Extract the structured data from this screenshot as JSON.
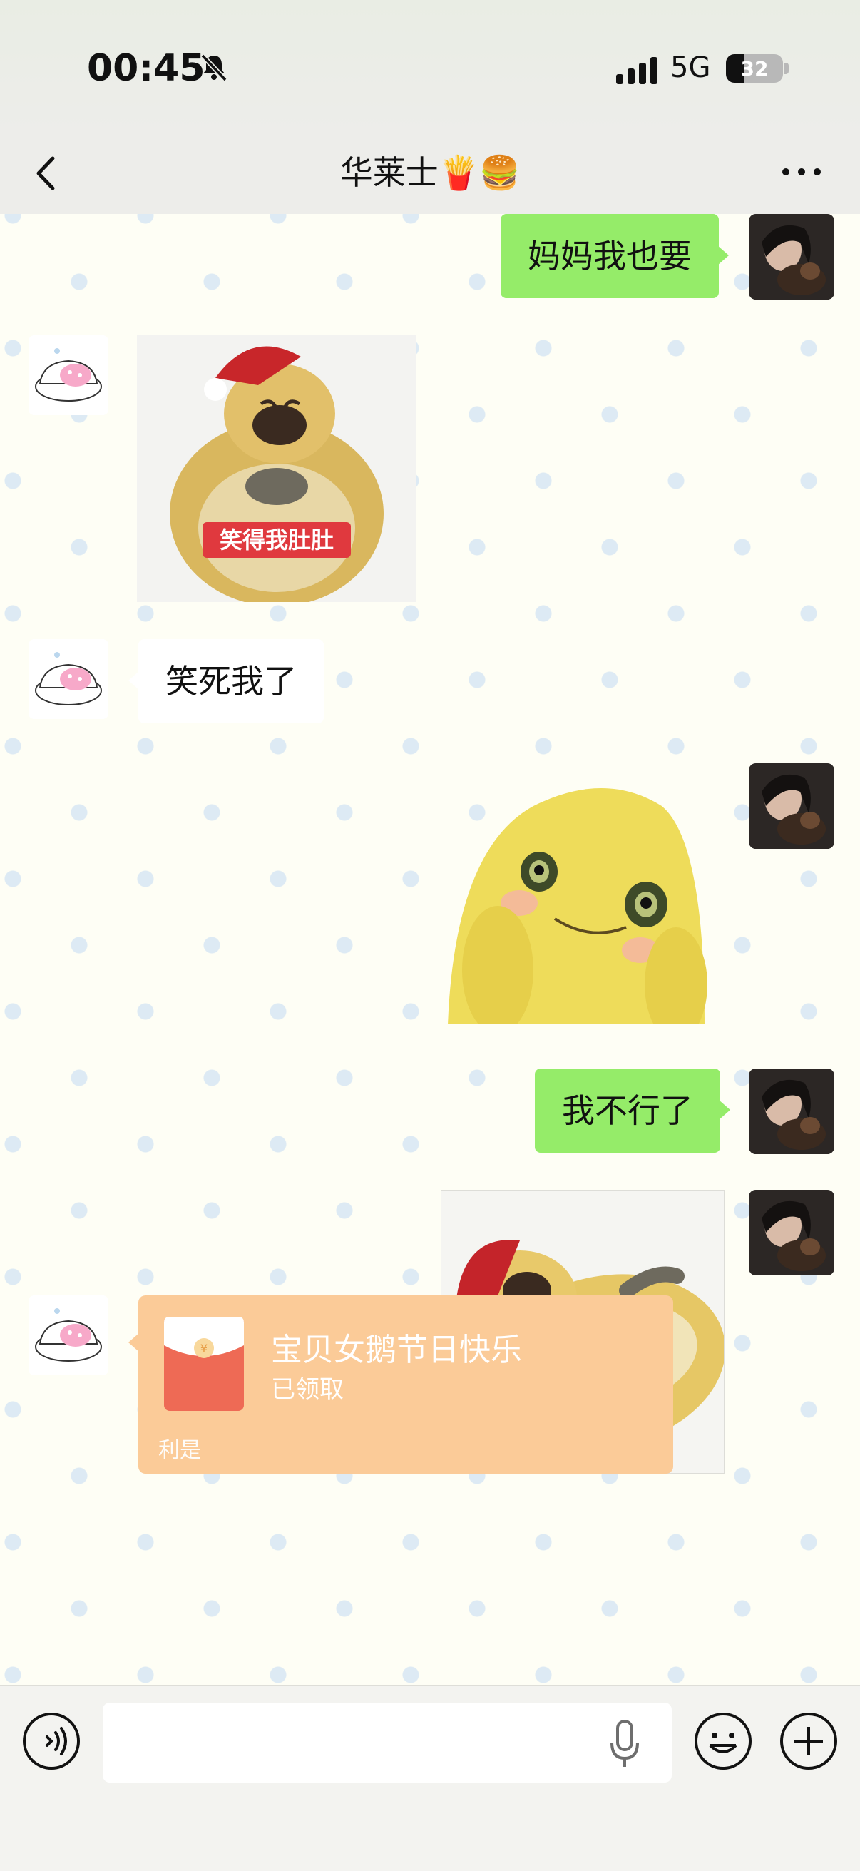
{
  "status_bar": {
    "time": "00:45",
    "network": "5G",
    "battery_level": "32",
    "battery_fraction": 0.32,
    "mute_icon": "bell-slash-icon",
    "signal_icon": "signal-bars-icon"
  },
  "nav": {
    "title": "华莱士🍟🍔",
    "back_icon": "chevron-left-icon",
    "more_icon": "more-dots-icon"
  },
  "messages": [
    {
      "side": "right",
      "type": "text",
      "text": "妈妈我也要"
    },
    {
      "side": "left",
      "type": "sticker",
      "caption": "笑得我肚肚"
    },
    {
      "side": "left",
      "type": "text",
      "text": "笑死我了"
    },
    {
      "side": "right",
      "type": "sticker"
    },
    {
      "side": "right",
      "type": "text",
      "text": "我不行了"
    },
    {
      "side": "right",
      "type": "sticker"
    },
    {
      "side": "left",
      "type": "red_packet",
      "title": "宝贝女鹅节日快乐",
      "status": "已领取",
      "footer": "利是"
    }
  ],
  "input_bar": {
    "placeholder": "",
    "voice_icon": "voice-icon",
    "mic_icon": "microphone-icon",
    "emoji_icon": "emoji-icon",
    "plus_icon": "plus-circle-icon"
  },
  "colors": {
    "own_bubble": "#95EC69",
    "other_bubble": "#FFFFFF",
    "red_packet": "#FBCB98",
    "chat_background": "#FEFEF5"
  }
}
